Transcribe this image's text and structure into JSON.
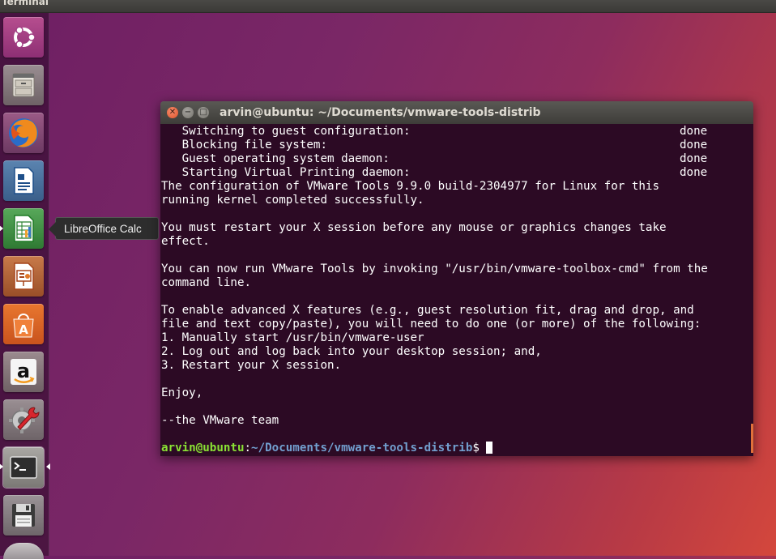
{
  "top_panel": {
    "title": "Terminal"
  },
  "launcher": {
    "items": [
      {
        "name": "ubuntu-dash",
        "icon": "ubuntu-logo-icon"
      },
      {
        "name": "files",
        "icon": "file-cabinet-icon"
      },
      {
        "name": "firefox",
        "icon": "firefox-icon"
      },
      {
        "name": "libreoffice-writer",
        "icon": "writer-document-icon"
      },
      {
        "name": "libreoffice-calc",
        "icon": "calc-spreadsheet-icon"
      },
      {
        "name": "libreoffice-impress",
        "icon": "impress-presentation-icon"
      },
      {
        "name": "ubuntu-software",
        "icon": "software-bag-icon"
      },
      {
        "name": "amazon",
        "icon": "amazon-icon"
      },
      {
        "name": "system-settings",
        "icon": "settings-wrench-icon"
      },
      {
        "name": "terminal",
        "icon": "terminal-icon"
      },
      {
        "name": "disk",
        "icon": "floppy-disk-icon"
      }
    ]
  },
  "tooltip": {
    "text": "LibreOffice Calc"
  },
  "terminal": {
    "title": "arvin@ubuntu: ~/Documents/vmware-tools-distrib",
    "status_lines": [
      {
        "text": "   Switching to guest configuration:",
        "status": "done"
      },
      {
        "text": "   Blocking file system:",
        "status": "done"
      },
      {
        "text": "   Guest operating system daemon:",
        "status": "done"
      },
      {
        "text": "   Starting Virtual Printing daemon:",
        "status": "done"
      }
    ],
    "output_lines": [
      "The configuration of VMware Tools 9.9.0 build-2304977 for Linux for this",
      "running kernel completed successfully.",
      "",
      "You must restart your X session before any mouse or graphics changes take",
      "effect.",
      "",
      "You can now run VMware Tools by invoking \"/usr/bin/vmware-toolbox-cmd\" from the",
      "command line.",
      "",
      "To enable advanced X features (e.g., guest resolution fit, drag and drop, and",
      "file and text copy/paste), you will need to do one (or more) of the following:",
      "1. Manually start /usr/bin/vmware-user",
      "2. Log out and log back into your desktop session; and,",
      "3. Restart your X session.",
      "",
      "Enjoy,",
      "",
      "--the VMware team",
      ""
    ],
    "prompt": {
      "user_host": "arvin@ubuntu",
      "separator": ":",
      "path": "~/Documents/vmware-tools-distrib",
      "symbol": "$ "
    }
  }
}
